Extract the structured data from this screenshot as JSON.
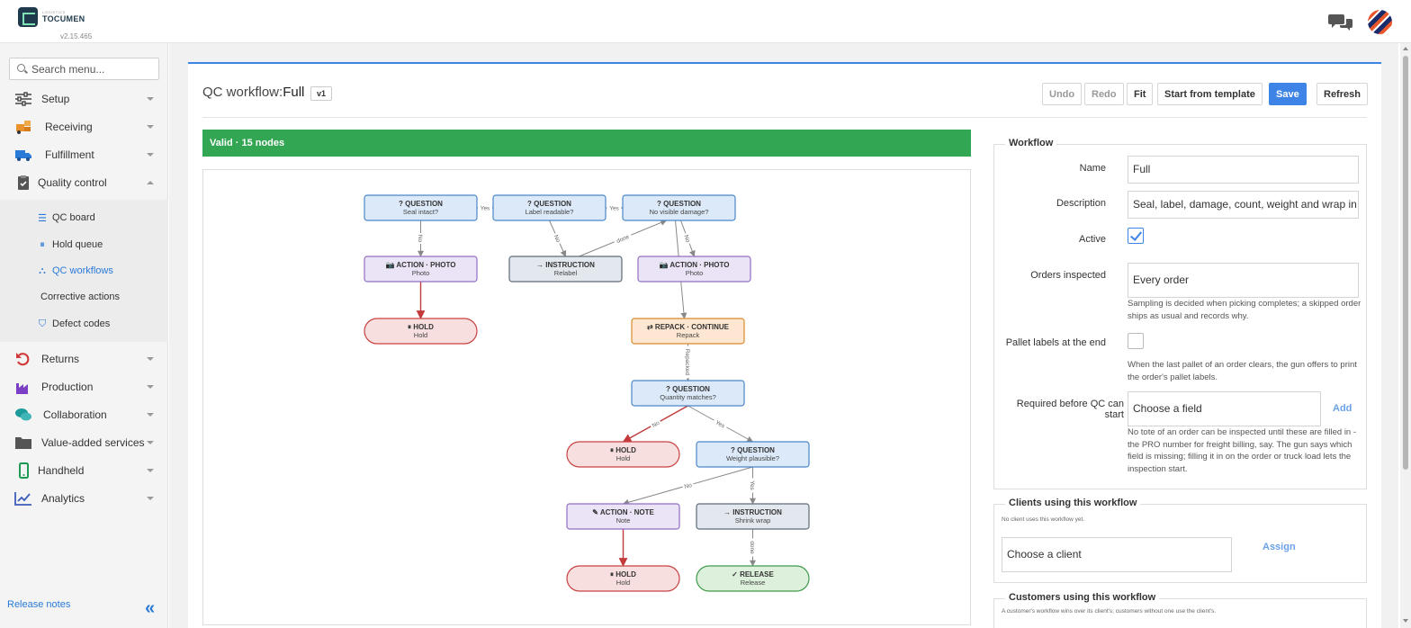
{
  "app": {
    "brand_small": "LOGISTICS",
    "brand": "TOCUMEN",
    "version": "v2.15.465"
  },
  "icons": {
    "chat": "chat-bubbles-icon",
    "avatar": "user-avatar",
    "search": "search-icon",
    "collapse": "double-chevron-left-icon"
  },
  "sidebar": {
    "search_placeholder": "Search menu...",
    "items": [
      {
        "label": "Setup",
        "icon": "sliders-icon"
      },
      {
        "label": "Receiving",
        "icon": "truck-boxes-icon"
      },
      {
        "label": "Fulfillment",
        "icon": "delivery-truck-icon"
      },
      {
        "label": "Quality control",
        "icon": "clipboard-check-icon",
        "expanded": true
      },
      {
        "label": "Returns",
        "icon": "return-arrow-icon"
      },
      {
        "label": "Production",
        "icon": "factory-icon"
      },
      {
        "label": "Collaboration",
        "icon": "chat-icon"
      },
      {
        "label": "Value-added services",
        "icon": "folder-icon"
      },
      {
        "label": "Handheld",
        "icon": "mobile-icon"
      },
      {
        "label": "Analytics",
        "icon": "line-chart-icon"
      }
    ],
    "sub_items": [
      {
        "label": "QC board",
        "icon": "list-icon"
      },
      {
        "label": "Hold queue",
        "icon": "pause-circle-icon"
      },
      {
        "label": "QC workflows",
        "icon": "flow-icon",
        "active": true
      },
      {
        "label": "Corrective actions",
        "icon": ""
      },
      {
        "label": "Defect codes",
        "icon": "tags-icon"
      }
    ],
    "release_notes": "Release notes"
  },
  "header": {
    "title_prefix": "QC workflow:",
    "title_name": "Full",
    "version_badge": "v1",
    "buttons": {
      "undo": "Undo",
      "redo": "Redo",
      "fit": "Fit",
      "template": "Start from template",
      "save": "Save",
      "refresh": "Refresh"
    }
  },
  "status": {
    "text": "Valid · 15 nodes",
    "color": "#33a653"
  },
  "diagram": {
    "nodes": [
      {
        "id": "q1",
        "type": "question",
        "title": "? QUESTION",
        "sub": "Seal intact?"
      },
      {
        "id": "q2",
        "type": "question",
        "title": "? QUESTION",
        "sub": "Label readable?"
      },
      {
        "id": "q3",
        "type": "question",
        "title": "? QUESTION",
        "sub": "No visible damage?"
      },
      {
        "id": "a1",
        "type": "action",
        "title": "📷 ACTION · PHOTO",
        "sub": "Photo"
      },
      {
        "id": "i1",
        "type": "instruction",
        "title": "→ INSTRUCTION",
        "sub": "Relabel"
      },
      {
        "id": "a2",
        "type": "action",
        "title": "📷 ACTION · PHOTO",
        "sub": "Photo"
      },
      {
        "id": "h1",
        "type": "hold",
        "title": "⏸ HOLD",
        "sub": "Hold"
      },
      {
        "id": "r1",
        "type": "repack",
        "title": "⇄ REPACK · CONTINUE",
        "sub": "Repack"
      },
      {
        "id": "q4",
        "type": "question",
        "title": "? QUESTION",
        "sub": "Quantity matches?"
      },
      {
        "id": "h2",
        "type": "hold",
        "title": "⏸ HOLD",
        "sub": "Hold"
      },
      {
        "id": "q5",
        "type": "question",
        "title": "? QUESTION",
        "sub": "Weight plausible?"
      },
      {
        "id": "a3",
        "type": "action",
        "title": "✎ ACTION · NOTE",
        "sub": "Note"
      },
      {
        "id": "i2",
        "type": "instruction",
        "title": "→ INSTRUCTION",
        "sub": "Shrink wrap"
      },
      {
        "id": "h3",
        "type": "hold",
        "title": "⏸ HOLD",
        "sub": "Hold"
      },
      {
        "id": "rel",
        "type": "release",
        "title": "✓ RELEASE",
        "sub": "Release"
      }
    ],
    "edges": [
      {
        "from": "q1",
        "to": "q2",
        "label": "Yes",
        "color": "gray"
      },
      {
        "from": "q2",
        "to": "q3",
        "label": "Yes",
        "color": "gray"
      },
      {
        "from": "q1",
        "to": "a1",
        "label": "No",
        "color": "gray"
      },
      {
        "from": "a1",
        "to": "h1",
        "label": "",
        "color": "red"
      },
      {
        "from": "q2",
        "to": "i1",
        "label": "No",
        "color": "gray"
      },
      {
        "from": "i1",
        "to": "q3",
        "label": "done",
        "color": "gray"
      },
      {
        "from": "q3",
        "to": "a2",
        "label": "No",
        "color": "gray"
      },
      {
        "from": "q3",
        "to": "r1",
        "label": "Yes",
        "color": "gray"
      },
      {
        "from": "r1",
        "to": "q4",
        "label": "Repacked",
        "color": "gray"
      },
      {
        "from": "q4",
        "to": "h2",
        "label": "No",
        "color": "red"
      },
      {
        "from": "q4",
        "to": "q5",
        "label": "Yes",
        "color": "gray"
      },
      {
        "from": "q5",
        "to": "a3",
        "label": "No",
        "color": "gray"
      },
      {
        "from": "q5",
        "to": "i2",
        "label": "Yes",
        "color": "gray"
      },
      {
        "from": "a3",
        "to": "h3",
        "label": "",
        "color": "red"
      },
      {
        "from": "i2",
        "to": "rel",
        "label": "done",
        "color": "gray"
      }
    ],
    "colors": {
      "question_fill": "#dbe9f8",
      "question_stroke": "#4a86c8",
      "action_fill": "#ebe3f6",
      "action_stroke": "#8f6fc4",
      "instruction_fill": "#e3e8ee",
      "instruction_stroke": "#5f6b78",
      "hold_fill": "#f8dfdf",
      "hold_stroke": "#c94040",
      "repack_fill": "#fde7d2",
      "repack_stroke": "#d9892f",
      "release_fill": "#dcf0dc",
      "release_stroke": "#3f9a4a",
      "edge_gray": "#888888",
      "edge_red": "#c23a3a"
    }
  },
  "workflow_form": {
    "legend": "Workflow",
    "name_label": "Name",
    "name_value": "Full",
    "description_label": "Description",
    "description_value": "Seal, label, damage, count, weight and wrap in",
    "active_label": "Active",
    "active": true,
    "orders_label": "Orders inspected",
    "orders_value": "Every order",
    "orders_help": "Sampling is decided when picking completes; a skipped order ships as usual and records why.",
    "pallet_label": "Pallet labels at the end",
    "pallet_checked": false,
    "pallet_help": "When the last pallet of an order clears, the gun offers to print the order's pallet labels.",
    "required_label": "Required before QC can start",
    "required_placeholder": "Choose a field",
    "required_add": "Add",
    "required_help": "No tote of an order can be inspected until these are filled in - the PRO number for freight billing, say. The gun says which field is missing; filling it in on the order or truck load lets the inspection start."
  },
  "clients_form": {
    "legend": "Clients using this workflow",
    "empty": "No client uses this workflow yet.",
    "placeholder": "Choose a client",
    "assign": "Assign"
  },
  "customers_form": {
    "legend": "Customers using this workflow",
    "note": "A customer's workflow wins over its client's; customers without one use the client's."
  }
}
